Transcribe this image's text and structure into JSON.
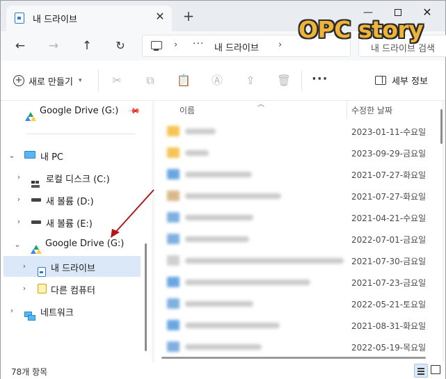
{
  "tab": {
    "title": "내 드라이브",
    "close_glyph": "✕",
    "new_tab_glyph": "+"
  },
  "window_controls": {
    "minimize": "—",
    "close": "✕"
  },
  "address_bar": {
    "separator": "›",
    "overflow": "···",
    "crumb": "내 드라이브",
    "search_placeholder": "내 드라이브 검색"
  },
  "watermark": "OPC story",
  "toolbar": {
    "new_label": "새로 만들기",
    "more_glyph": "···",
    "details_label": "세부 정보"
  },
  "sidebar": {
    "items": [
      {
        "label": "Google Drive (G:)",
        "icon": "google-drive-icon",
        "pinned": true
      },
      {
        "label": "내 PC",
        "icon": "pc-icon",
        "expanded": true
      },
      {
        "label": "로컬 디스크 (C:)",
        "icon": "local-disk-icon"
      },
      {
        "label": "새 볼륨 (D:)",
        "icon": "drive-icon"
      },
      {
        "label": "새 볼륨 (E:)",
        "icon": "drive-icon"
      },
      {
        "label": "Google Drive (G:)",
        "icon": "google-drive-icon",
        "expanded": true
      },
      {
        "label": "내 드라이브",
        "icon": "my-drive-icon",
        "selected": true
      },
      {
        "label": "다른 컴퓨터",
        "icon": "other-computers-icon"
      },
      {
        "label": "네트워크",
        "icon": "network-icon"
      }
    ]
  },
  "file_list": {
    "columns": {
      "name": "이름",
      "date": "수정한 날짜"
    },
    "rows": [
      {
        "date": "2023-01-11-수요일",
        "icon_color": "#f6c453"
      },
      {
        "date": "2023-09-29-금요일",
        "icon_color": "#f6c453"
      },
      {
        "date": "2021-07-27-화요일",
        "icon_color": "#6aa7e2"
      },
      {
        "date": "2021-07-27-화요일",
        "icon_color": "#d9b98a"
      },
      {
        "date": "2021-04-21-수요일",
        "icon_color": "#7fb0e0"
      },
      {
        "date": "2022-07-01-금요일",
        "icon_color": "#7fb0e0"
      },
      {
        "date": "2021-07-30-금요일",
        "icon_color": "#d0d0d0"
      },
      {
        "date": "2021-07-23-금요일",
        "icon_color": "#6aa7e2"
      },
      {
        "date": "2022-05-21-토요일",
        "icon_color": "#7fb0e0"
      },
      {
        "date": "2021-08-31-화요일",
        "icon_color": "#6aa7e2"
      },
      {
        "date": "2022-05-19-목요일",
        "icon_color": "#7fb0e0"
      }
    ]
  },
  "status_bar": {
    "item_count": "78개 항목"
  },
  "colors": {
    "accent": "#2a7ad5",
    "selection": "#dbe8f7",
    "annotation_arrow": "#b01818",
    "watermark": "#f0b33a"
  }
}
